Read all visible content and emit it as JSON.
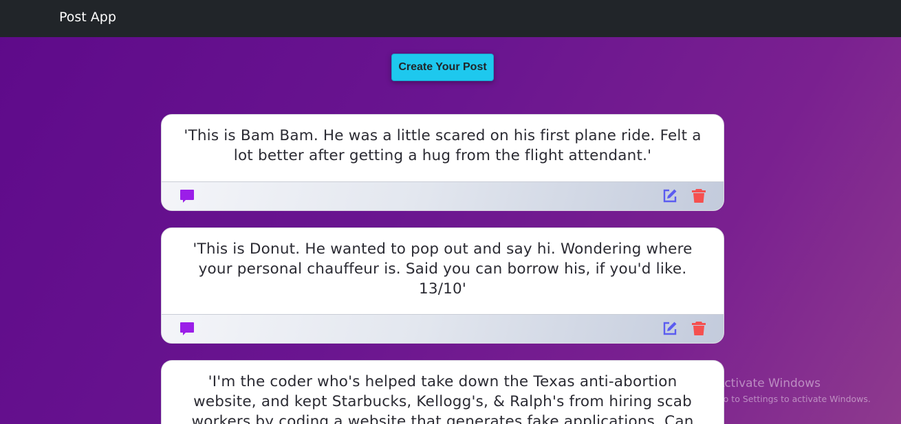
{
  "navbar": {
    "brand": "Post App"
  },
  "toolbar": {
    "create_label": "Create Your Post"
  },
  "posts": [
    {
      "text": "'This is Bam Bam. He was a little scared on his first plane ride. Felt a lot better after getting a hug from the flight attendant.'"
    },
    {
      "text": "'This is Donut. He wanted to pop out and say hi. Wondering where your personal chauffeur is. Said you can borrow his, if you'd like. 13/10'"
    },
    {
      "text": "'I'm the coder who's helped take down the Texas anti-abortion website, and kept Starbucks, Kellogg's, & Ralph's from hiring scab workers by coding a website that generates fake applications. Can"
    }
  ],
  "icons": {
    "comment": "comment-icon",
    "edit": "edit-icon",
    "delete": "trash-icon"
  },
  "colors": {
    "navbar": "#212529",
    "button": "#1ec8ee",
    "comment_icon": "#9b1ee8",
    "edit_icon": "#5b5cf0",
    "delete_icon": "#f5504f"
  },
  "watermark": {
    "title": "Activate Windows",
    "subtitle": "Go to Settings to activate Windows."
  }
}
